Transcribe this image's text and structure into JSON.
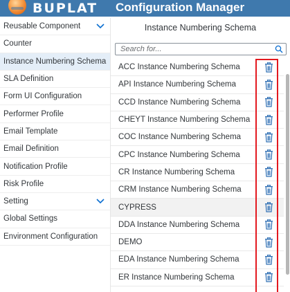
{
  "brand": {
    "logo_text": "BUPLAT",
    "app_title": "Configuration Manager"
  },
  "colors": {
    "header": "#3f79ad",
    "selected": "#e4eef8",
    "highlight_box": "#e3181f",
    "delete_icon": "#2f6fb4"
  },
  "sidebar": {
    "items": [
      {
        "label": "Reusable Component",
        "icon": "chevron-down-icon"
      },
      {
        "label": "Counter"
      },
      {
        "label": "Instance Numbering Schema",
        "selected": true
      },
      {
        "label": "SLA Definition"
      },
      {
        "label": "Form UI Configuration"
      },
      {
        "label": "Performer Profile"
      },
      {
        "label": "Email Template"
      },
      {
        "label": "Email Definition"
      },
      {
        "label": "Notification Profile"
      },
      {
        "label": "Risk Profile"
      },
      {
        "label": "Setting",
        "icon": "chevron-down-icon"
      },
      {
        "label": "Global Settings"
      },
      {
        "label": "Environment Configuration"
      }
    ]
  },
  "main": {
    "title": "Instance Numbering Schema",
    "search": {
      "placeholder": "Search for...",
      "value": "",
      "icon": "search-icon"
    },
    "rows": [
      {
        "label": "ACC Instance Numbering Schema"
      },
      {
        "label": "API Instance Numbering Schema"
      },
      {
        "label": "CCD Instance Numbering Schema"
      },
      {
        "label": "CHEYT Instance Numbering Schema"
      },
      {
        "label": "COC Instance Numbering Schema"
      },
      {
        "label": "CPC Instance Numbering Schema"
      },
      {
        "label": "CR Instance Numbering Schema"
      },
      {
        "label": "CRM Instance Numbering Schema"
      },
      {
        "label": "CYPRESS",
        "highlighted": true
      },
      {
        "label": "DDA Instance Numbering Schema"
      },
      {
        "label": "DEMO"
      },
      {
        "label": "EDA Instance Numbering Schema"
      },
      {
        "label": "ER Instance Numbering Schema"
      }
    ],
    "row_action_icon": "trash-icon"
  }
}
